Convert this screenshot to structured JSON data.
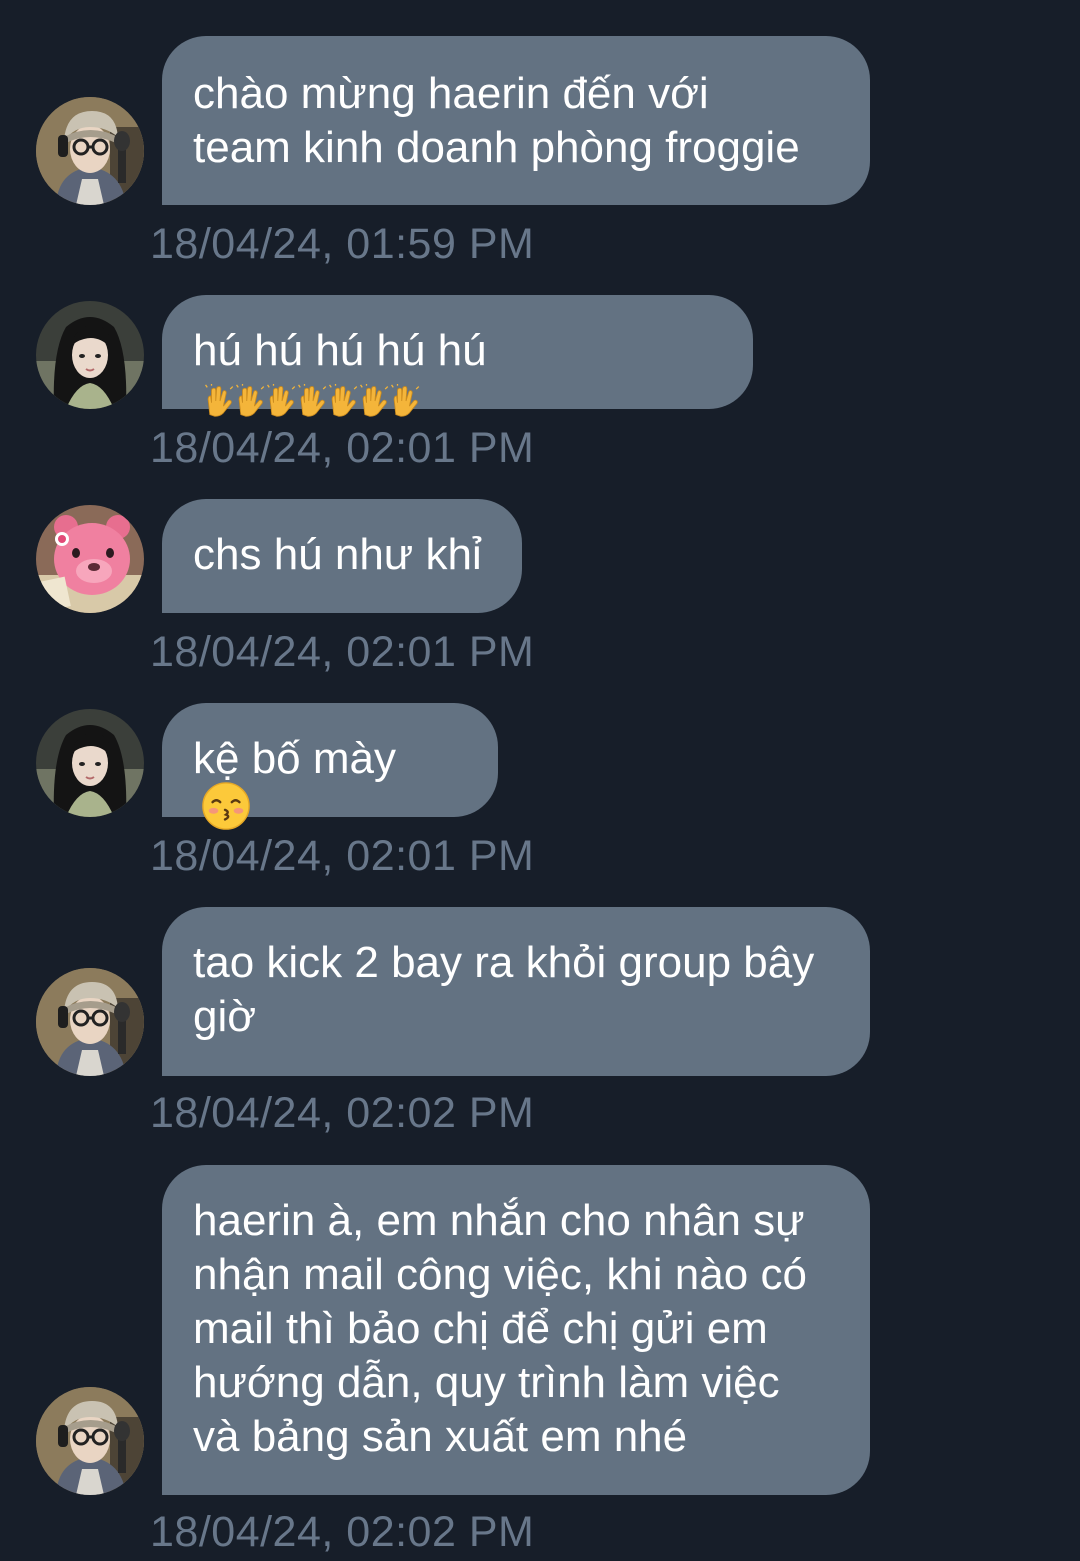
{
  "messages": [
    {
      "sender": "user_a",
      "avatar_icon": "avatar-cap-glasses",
      "text": "chào mừng haerin đến với\nteam kinh doanh phòng froggie",
      "timestamp": "18/04/24, 01:59 PM"
    },
    {
      "sender": "user_b",
      "avatar_icon": "avatar-dark-hair",
      "text": "hú hú hú hú hú",
      "emoji": "raising-hands-x7",
      "timestamp": "18/04/24, 02:01 PM"
    },
    {
      "sender": "user_c",
      "avatar_icon": "avatar-pink-bear",
      "text": "chs hú như khỉ",
      "timestamp": "18/04/24, 02:01 PM"
    },
    {
      "sender": "user_b",
      "avatar_icon": "avatar-dark-hair",
      "text": "kệ bố mày",
      "emoji": "kissing-face-closed-eyes",
      "timestamp": "18/04/24, 02:01 PM"
    },
    {
      "sender": "user_a",
      "avatar_icon": "avatar-cap-glasses",
      "text": "tao kick 2 bay ra khỏi group bây\ngiờ",
      "timestamp": "18/04/24, 02:02 PM"
    },
    {
      "sender": "user_a",
      "avatar_icon": "avatar-cap-glasses",
      "text": "haerin à, em nhắn cho nhân sự\nnhận mail công việc, khi nào có\nmail thì bảo chị để chị gửi em\nhướng dẫn, quy trình làm việc\nvà bảng sản xuất em nhé",
      "timestamp": "18/04/24, 02:02 PM"
    }
  ],
  "colors": {
    "background": "#171e29",
    "bubble": "#637282",
    "timestamp": "#68778a",
    "text": "#ffffff"
  }
}
